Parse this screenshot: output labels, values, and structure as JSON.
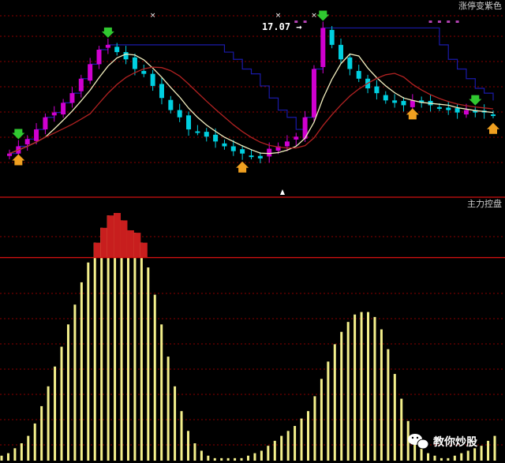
{
  "panels": {
    "main_title": "涨停变紫色",
    "sub_title": "主力控盘",
    "watermark": "教你炒股"
  },
  "colors": {
    "up_candle": "#d000d0",
    "down_candle": "#00d0e0",
    "ma_short": "#f4f0c0",
    "ma_long": "#b22222",
    "step_line": "#1a1aa8",
    "grid": "#8b0000",
    "bar_fill": "#f4f08c",
    "bar_over": "#c81e1e",
    "threshold": "#d01010",
    "sell_arrow": "#30c830",
    "buy_arrow": "#f0a020"
  },
  "chart_data": [
    {
      "type": "candlestick",
      "title": "涨停变紫色",
      "ylim": [
        14.2,
        17.4
      ],
      "annotations": [
        {
          "type": "max_price",
          "text": "17.07 →",
          "value": 17.07,
          "index": 34
        }
      ],
      "close": [
        14.45,
        14.6,
        14.75,
        14.95,
        15.2,
        15.3,
        15.5,
        15.7,
        16.0,
        16.3,
        16.6,
        16.7,
        16.55,
        16.4,
        16.2,
        16.1,
        15.85,
        15.6,
        15.35,
        15.2,
        14.95,
        14.9,
        14.8,
        14.7,
        14.6,
        14.5,
        14.45,
        14.4,
        14.35,
        14.55,
        14.6,
        14.7,
        14.8,
        15.2,
        16.2,
        17.05,
        16.7,
        16.4,
        16.2,
        16.0,
        15.8,
        15.7,
        15.55,
        15.5,
        15.45,
        15.55,
        15.5,
        15.45,
        15.4,
        15.35,
        15.3,
        15.35,
        15.3,
        15.3,
        15.25
      ],
      "sell_signals": [
        1,
        11,
        35,
        52
      ],
      "buy_signals": [
        1,
        26,
        45,
        54
      ],
      "limit_up_marks": [
        16,
        30,
        34
      ],
      "pink_marks": [
        32,
        33,
        47,
        48,
        49,
        50
      ]
    },
    {
      "type": "bar",
      "title": "主力控盘",
      "threshold_fraction": 0.82,
      "values": [
        0.02,
        0.03,
        0.05,
        0.07,
        0.1,
        0.15,
        0.22,
        0.3,
        0.38,
        0.46,
        0.55,
        0.63,
        0.72,
        0.8,
        0.88,
        0.94,
        0.99,
        1.0,
        0.97,
        0.93,
        0.92,
        0.88,
        0.78,
        0.67,
        0.55,
        0.42,
        0.3,
        0.2,
        0.12,
        0.07,
        0.04,
        0.02,
        0.01,
        0.01,
        0.01,
        0.01,
        0.01,
        0.02,
        0.03,
        0.04,
        0.06,
        0.08,
        0.1,
        0.12,
        0.14,
        0.17,
        0.2,
        0.26,
        0.33,
        0.4,
        0.47,
        0.52,
        0.56,
        0.59,
        0.6,
        0.6,
        0.58,
        0.53,
        0.45,
        0.35,
        0.25,
        0.16,
        0.09,
        0.05,
        0.03,
        0.02,
        0.01,
        0.01,
        0.02,
        0.03,
        0.04,
        0.05,
        0.06,
        0.08,
        0.1
      ]
    }
  ]
}
